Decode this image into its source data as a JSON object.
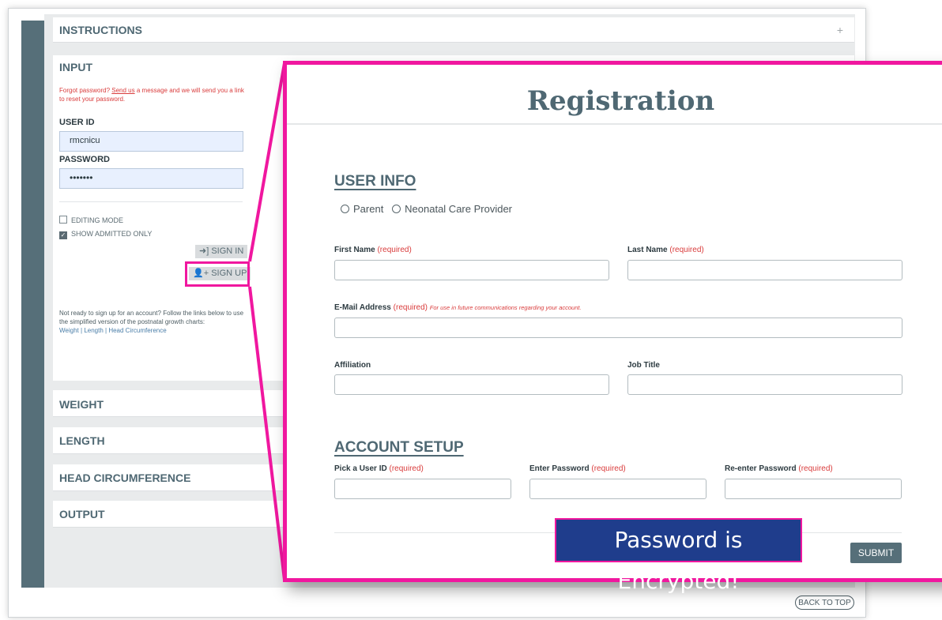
{
  "sections": {
    "instructions": "INSTRUCTIONS",
    "input": "INPUT",
    "weight": "WEIGHT",
    "length": "LENGTH",
    "head_circumference": "HEAD CIRCUMFERENCE",
    "output": "OUTPUT",
    "expand_icon": "+"
  },
  "login": {
    "forgot_prefix": "Forgot password?",
    "forgot_link": "Send us",
    "forgot_suffix": "a message and we will send you a link to reset your password.",
    "user_id_label": "USER ID",
    "user_id_value": "rmcnicu",
    "password_label": "PASSWORD",
    "password_value": "•••••••",
    "editing_mode": "EDITING MODE",
    "show_admitted": "SHOW ADMITTED ONLY",
    "editing_mode_checked": false,
    "show_admitted_checked": true,
    "sign_in": "SIGN IN",
    "sign_up": "SIGN UP",
    "not_ready": "Not ready to sign up for an account? Follow the links below to use the simplified version of the postnatal growth charts:",
    "link_weight": "Weight",
    "link_length": "Length",
    "link_head": "Head Circumference",
    "link_sep": "|"
  },
  "back_to_top": "BACK TO TOP",
  "registration": {
    "title": "Registration",
    "user_info_heading": "USER INFO",
    "role_parent": "Parent",
    "role_provider": "Neonatal Care Provider",
    "first_name": "First Name",
    "last_name": "Last Name",
    "email": "E-Mail Address",
    "email_note": "For use in future communications regarding your account.",
    "affiliation": "Affiliation",
    "job_title": "Job Title",
    "account_heading": "ACCOUNT SETUP",
    "pick_user_id": "Pick a User ID",
    "enter_password": "Enter Password",
    "reenter_password": "Re-enter Password",
    "required": "(required)",
    "submit": "SUBMIT"
  },
  "callout": "Password is Encrypted!",
  "colors": {
    "highlight": "#f0179f",
    "slate": "#566f79",
    "callout_bg": "#1f3d8c",
    "required_red": "#d93c3c"
  }
}
